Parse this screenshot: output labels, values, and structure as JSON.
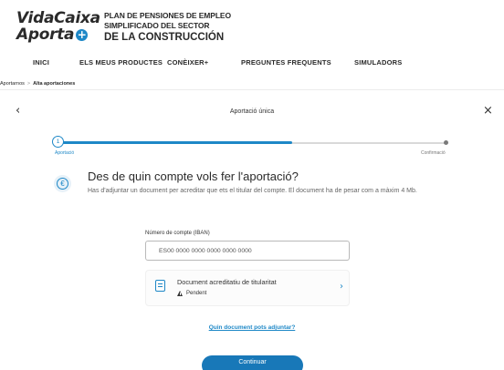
{
  "brand": {
    "logo_line1": "VidaCaixa",
    "logo_line2": "Aporta",
    "logo_plus": "+",
    "plan_line1": "PLAN DE PENSIONES DE EMPLEO",
    "plan_line2": "SIMPLIFICADO DEL SECTOR",
    "plan_line3": "DE LA CONSTRUCCIÓN",
    "accent_color": "#1e88c7"
  },
  "nav": {
    "items": [
      {
        "label": "INICI"
      },
      {
        "label": "ELS MEUS PRODUCTES"
      },
      {
        "label": "CONÈIXER+"
      },
      {
        "label": "PREGUNTES FREQUENTS"
      },
      {
        "label": "SIMULADORS"
      }
    ]
  },
  "breadcrumb": {
    "items": [
      "Aportarnos",
      "Alta aportaciones"
    ],
    "separator": ">"
  },
  "step": {
    "title": "Aportació única",
    "back_icon": "chevron-left-icon",
    "close_icon": "close-icon"
  },
  "progress": {
    "current_step": "1",
    "label_start": "Aportació",
    "label_end": "Confirmació",
    "fraction_complete": 0.6
  },
  "question": {
    "icon": "euro-icon",
    "title": "Des de quin compte vols fer l'aportació?",
    "description": "Has d'adjuntar un document per acreditar que ets el titular del compte. El document ha de pesar com a màxim 4 Mb."
  },
  "iban": {
    "label": "Número de compte (IBAN)",
    "placeholder": "ES00 0000 0000 0000 0000 0000",
    "value": ""
  },
  "document": {
    "icon": "document-icon",
    "name": "Document acreditatiu de titularitat",
    "status_icon": "warning-icon",
    "status": "Pendent",
    "chevron_icon": "chevron-right-icon"
  },
  "help_link": "Quin document pots adjuntar?",
  "continue_button": "Continuar"
}
